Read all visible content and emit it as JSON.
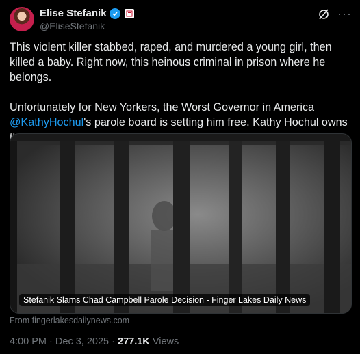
{
  "author": {
    "name": "Elise Stefanik",
    "handle": "@EliseStefanik"
  },
  "tweet": {
    "paragraph1": "This violent killer stabbed, raped, and murdered a young girl, then killed a baby.  Right now, this heinous criminal in prison where he belongs.",
    "paragraph2_before": "Unfortunately for New Yorkers, the Worst Governor in America ",
    "mention": "@KathyHochul",
    "paragraph2_after": "'s parole board is setting him free.  Kathy Hochul owns this crime crisis in our state."
  },
  "card": {
    "caption": "Stefanik Slams Chad Campbell Parole Decision - Finger Lakes Daily News",
    "source": "From fingerlakesdailynews.com"
  },
  "meta": {
    "time": "4:00 PM",
    "date": "Dec 3, 2025",
    "views_count": "277.1K",
    "views_label": "Views",
    "separator": "·"
  },
  "icons": {
    "verified": "verified-badge-icon",
    "gov": "government-label-icon",
    "grok": "grok-icon",
    "more": "more-options-icon"
  },
  "colors": {
    "background": "#000000",
    "text": "#e7e9ea",
    "secondary": "#71767b",
    "accent": "#1d9bf0"
  }
}
